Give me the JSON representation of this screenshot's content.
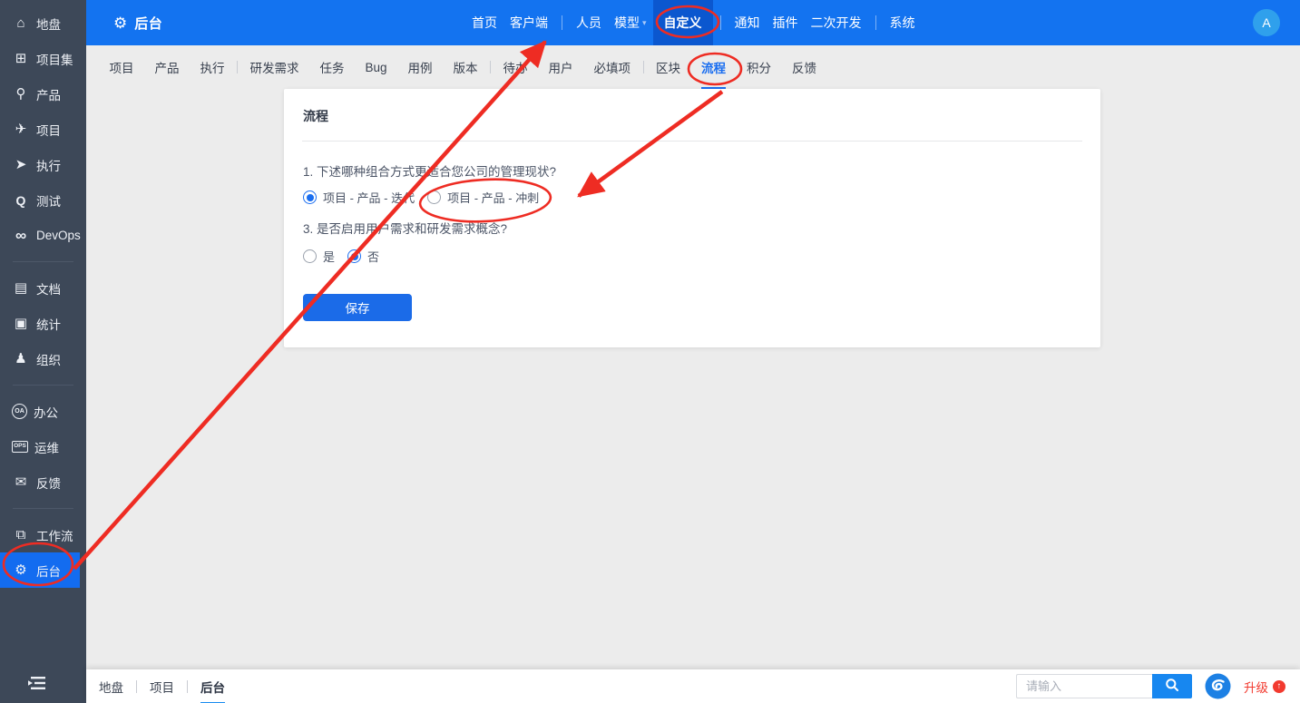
{
  "colors": {
    "topbar": "#1373f0",
    "topbar_active": "#0b57cf",
    "sidebar": "#3d4858",
    "accent": "#1a6ef0",
    "main_bg": "#ececec",
    "annotation_red": "#ee2c23",
    "upgrade_red": "#f23a2f"
  },
  "topbar": {
    "app_icon": "gear-icon",
    "app_label": "后台",
    "nav": [
      {
        "label": "首页"
      },
      {
        "label": "客户端"
      },
      {
        "divider": true
      },
      {
        "label": "人员"
      },
      {
        "label": "模型",
        "caret": true,
        "caret_glyph": "▾"
      },
      {
        "label": "自定义",
        "active": true
      },
      {
        "divider": true
      },
      {
        "label": "通知"
      },
      {
        "label": "插件"
      },
      {
        "label": "二次开发"
      },
      {
        "divider": true
      },
      {
        "label": "系统"
      }
    ],
    "avatar": "A"
  },
  "sidebar": {
    "items": [
      {
        "icon": "home-icon",
        "label": "地盘"
      },
      {
        "icon": "grid-icon",
        "label": "项目集"
      },
      {
        "icon": "bulb-icon",
        "label": "产品"
      },
      {
        "icon": "rocket-icon",
        "label": "项目"
      },
      {
        "icon": "run-icon",
        "label": "执行"
      },
      {
        "icon": "search-q-icon",
        "label": "测试"
      },
      {
        "icon": "infinity-icon",
        "label": "DevOps"
      },
      {
        "divider": true
      },
      {
        "icon": "doc-icon",
        "label": "文档"
      },
      {
        "icon": "stats-icon",
        "label": "统计"
      },
      {
        "icon": "people-icon",
        "label": "组织"
      },
      {
        "divider": true
      },
      {
        "icon": "oa-icon",
        "label": "办公"
      },
      {
        "icon": "ops-icon",
        "label": "运维"
      },
      {
        "icon": "mail-icon",
        "label": "反馈"
      },
      {
        "divider": true
      },
      {
        "icon": "workflow-icon",
        "label": "工作流"
      },
      {
        "icon": "gear-icon",
        "label": "后台",
        "active": true
      }
    ]
  },
  "subnav": {
    "tabs": [
      {
        "label": "项目"
      },
      {
        "label": "产品"
      },
      {
        "label": "执行"
      },
      {
        "divider": true
      },
      {
        "label": "研发需求"
      },
      {
        "label": "任务"
      },
      {
        "label": "Bug"
      },
      {
        "label": "用例"
      },
      {
        "label": "版本"
      },
      {
        "divider": true
      },
      {
        "label": "待办"
      },
      {
        "label": "用户"
      },
      {
        "label": "必填项"
      },
      {
        "divider": true
      },
      {
        "label": "区块"
      },
      {
        "label": "流程",
        "active": true
      },
      {
        "label": "积分"
      },
      {
        "label": "反馈"
      }
    ]
  },
  "panel": {
    "title": "流程",
    "question1": "1. 下述哪种组合方式更适合您公司的管理现状?",
    "q1_options": [
      {
        "label": "项目 - 产品 - 迭代",
        "selected": true
      },
      {
        "label": "项目 - 产品 - 冲刺",
        "selected": false
      }
    ],
    "question3": "3. 是否启用用户需求和研发需求概念?",
    "q3_options": [
      {
        "label": "是",
        "selected": false
      },
      {
        "label": "否",
        "selected": true
      }
    ],
    "save_label": "保存"
  },
  "bottombar": {
    "tabs": [
      {
        "label": "地盘"
      },
      {
        "divider": true
      },
      {
        "label": "项目"
      },
      {
        "divider": true
      },
      {
        "label": "后台",
        "active": true
      }
    ],
    "search_placeholder": "请输入",
    "upgrade_label": "升级"
  }
}
